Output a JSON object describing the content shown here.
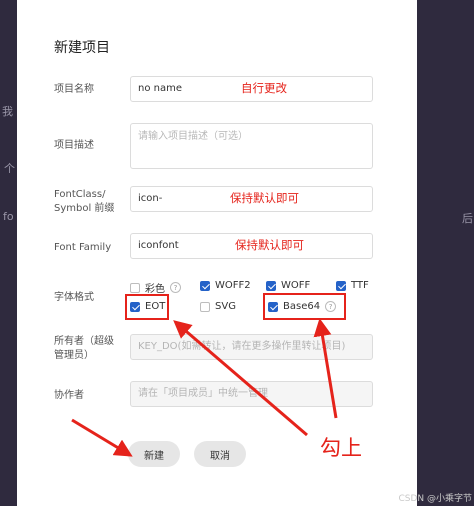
{
  "background": {
    "left_fragments": [
      "我",
      "个",
      "fo"
    ],
    "right_fragments": [
      "后"
    ]
  },
  "dialog": {
    "title": "新建项目",
    "fields": {
      "name": {
        "label": "项目名称",
        "value": "no name",
        "annotation": "自行更改"
      },
      "desc": {
        "label": "项目描述",
        "placeholder": "请输入项目描述（可选）"
      },
      "prefix": {
        "label_line1": "FontClass/",
        "label_line2": "Symbol 前缀",
        "value": "icon-",
        "annotation": "保持默认即可"
      },
      "family": {
        "label": "Font Family",
        "value": "iconfont",
        "annotation": "保持默认即可"
      },
      "format": {
        "label": "字体格式",
        "options": [
          {
            "label": "彩色",
            "checked": false,
            "help": "?"
          },
          {
            "label": "WOFF2",
            "checked": true
          },
          {
            "label": "WOFF",
            "checked": true
          },
          {
            "label": "TTF",
            "checked": true
          },
          {
            "label": "EOT",
            "checked": true
          },
          {
            "label": "SVG",
            "checked": false
          },
          {
            "label": "Base64",
            "checked": true,
            "help": "?"
          }
        ]
      },
      "owner": {
        "label_line1": "所有者（超级",
        "label_line2": "管理员）",
        "value": "KEY_DO(如需转让，请在更多操作里转让项目)"
      },
      "collab": {
        "label": "协作者",
        "placeholder": "请在「项目成员」中统一管理"
      }
    },
    "buttons": {
      "create": "新建",
      "cancel": "取消"
    },
    "big_annotation": "勾上"
  },
  "watermark": "CSDN @小乘字节",
  "colors": {
    "annotation": "#e5231b",
    "checkbox": "#2462c8",
    "backdrop": "#2f2a3e"
  }
}
